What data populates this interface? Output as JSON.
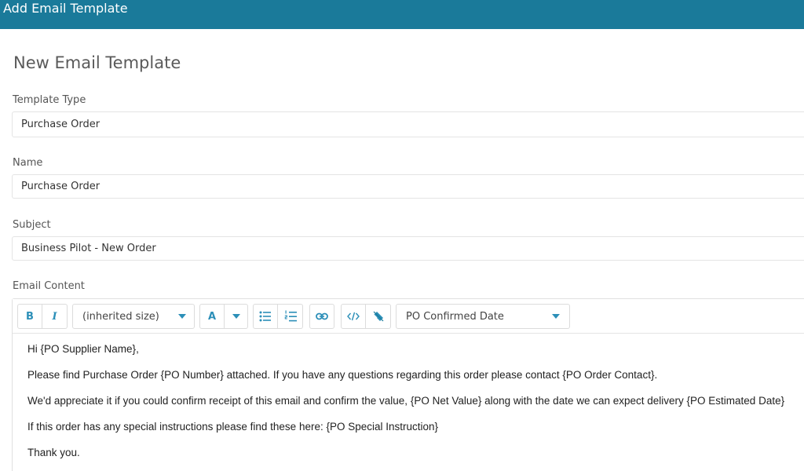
{
  "window": {
    "title": "Add Email Template"
  },
  "page": {
    "title": "New Email Template"
  },
  "fields": {
    "template_type": {
      "label": "Template Type",
      "value": "Purchase Order"
    },
    "name": {
      "label": "Name",
      "value": "Purchase Order"
    },
    "subject": {
      "label": "Subject",
      "value": "Business Pilot - New Order"
    },
    "content": {
      "label": "Email Content"
    }
  },
  "toolbar": {
    "bold": "B",
    "italic": "I",
    "font_size": "(inherited size)",
    "color": "A",
    "placeholder_select": "PO Confirmed Date"
  },
  "email_body": {
    "line1": "Hi {PO Supplier Name},",
    "line2": "Please find Purchase Order {PO Number} attached. If you have any questions regarding this order please contact {PO Order Contact}.",
    "line3": "We'd appreciate it if you could confirm receipt of this email and confirm the value, {PO Net Value} along with the date we can expect delivery {PO Estimated Date}",
    "line4": "If this order has any special instructions please find these here: {PO Special Instruction}",
    "line5": "Thank you."
  },
  "colors": {
    "header": "#1a7a9a",
    "accent": "#2c8fb8"
  }
}
